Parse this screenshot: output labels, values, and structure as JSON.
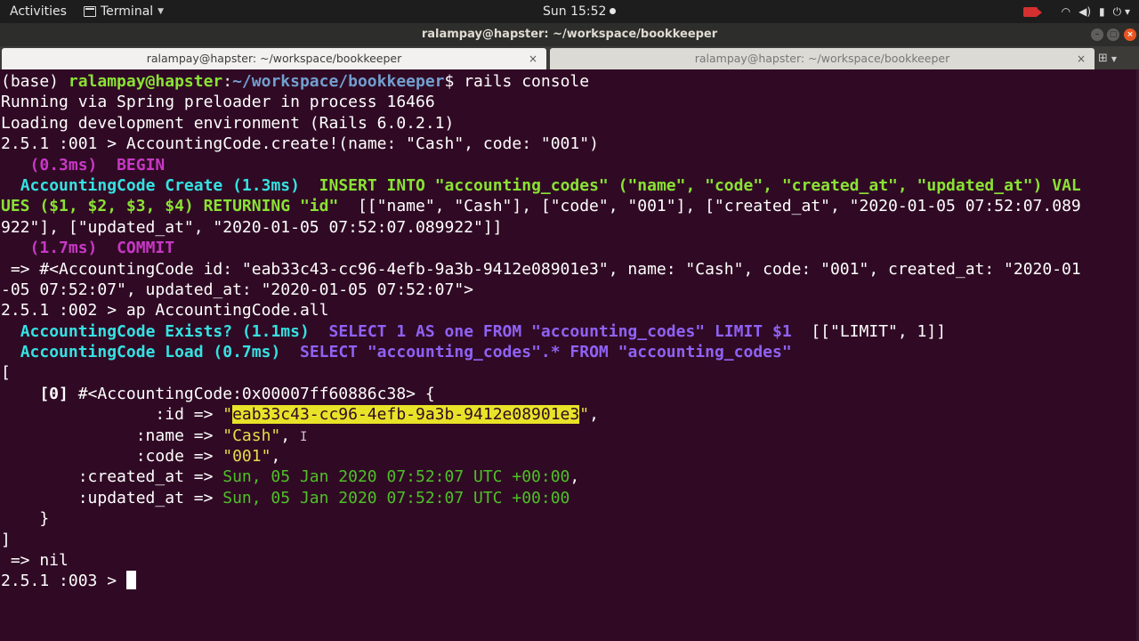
{
  "topbar": {
    "activities": "Activities",
    "app_menu": "Terminal",
    "clock": "Sun 15:52",
    "tray_icons": [
      "camera-icon",
      "wifi-icon",
      "volume-icon",
      "battery-icon",
      "power-menu-icon"
    ]
  },
  "window": {
    "title": "ralampay@hapster: ~/workspace/bookkeeper",
    "buttons": [
      "minimize",
      "maximize",
      "close"
    ]
  },
  "tabs": [
    {
      "label": "ralampay@hapster: ~/workspace/bookkeeper",
      "active": true
    },
    {
      "label": "ralampay@hapster: ~/workspace/bookkeeper",
      "active": false
    }
  ],
  "terminal": {
    "prompt": {
      "env": "(base) ",
      "user_host": "ralampay@hapster",
      "sep": ":",
      "path": "~/workspace/bookkeeper",
      "dollar": "$ ",
      "command": "rails console"
    },
    "spring": "Running via Spring preloader in process 16466",
    "loading": "Loading development environment (Rails 6.0.2.1)",
    "irb1_prompt": "2.5.1 :001 > ",
    "irb1_cmd": "AccountingCode.create!(name: \"Cash\", code: \"001\")",
    "begin_time": "(0.3ms)",
    "begin_kw": "BEGIN",
    "create_label": "AccountingCode Create (1.3ms)",
    "insert_sql_1": "INSERT INTO \"accounting_codes\" (\"name\", \"code\", \"created_at\", \"updated_at\") VAL",
    "insert_sql_2": "UES ($1, $2, $3, $4) RETURNING \"id\"",
    "insert_binds_1": "  [[\"name\", \"Cash\"], [\"code\", \"001\"], [\"created_at\", \"2020-01-05 07:52:07.089",
    "insert_binds_2": "922\"], [\"updated_at\", \"2020-01-05 07:52:07.089922\"]]",
    "commit_time": "(1.7ms)",
    "commit_kw": "COMMIT",
    "result_1": " => #<AccountingCode id: \"eab33c43-cc96-4efb-9a3b-9412e08901e3\", name: \"Cash\", code: \"001\", created_at: \"2020-01",
    "result_2": "-05 07:52:07\", updated_at: \"2020-01-05 07:52:07\">",
    "irb2_prompt": "2.5.1 :002 > ",
    "irb2_cmd": "ap AccountingCode.all",
    "exists_label": "AccountingCode Exists? (1.1ms)",
    "exists_sql": "SELECT 1 AS one FROM \"accounting_codes\" LIMIT $1",
    "exists_binds": "  [[\"LIMIT\", 1]]",
    "load_label": "AccountingCode Load (0.7ms)",
    "load_sql": "SELECT \"accounting_codes\".* FROM \"accounting_codes\"",
    "open_bracket": "[",
    "record_index": "    [0]",
    "record_header": " #<AccountingCode:0x00007ff60886c38> {",
    "id_key": "                :id => ",
    "id_value": "eab33c43-cc96-4efb-9a3b-9412e08901e3",
    "name_key": "              :name => ",
    "name_value": "\"Cash\"",
    "code_key": "              :code => ",
    "code_value": "\"001\"",
    "created_key": "        :created_at => ",
    "created_value": "Sun, 05 Jan 2020 07:52:07 UTC +00:00",
    "updated_key": "        :updated_at => ",
    "updated_value": "Sun, 05 Jan 2020 07:52:07 UTC +00:00",
    "record_close": "    }",
    "close_bracket": "]",
    "nil_result": " => nil",
    "irb3_prompt": "2.5.1 :003 > "
  }
}
